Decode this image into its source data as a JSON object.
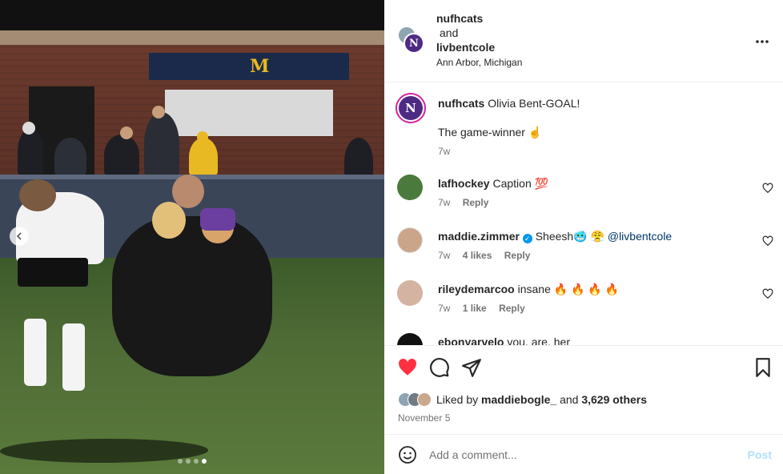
{
  "header": {
    "user1": "nufhcats",
    "and": "and",
    "user2": "livbentcole",
    "location": "Ann Arbor, Michigan",
    "avatar_letter": "N"
  },
  "caption": {
    "username": "nufhcats",
    "line1": "Olivia Bent-GOAL!",
    "line2": "The game-winner ☝️",
    "time": "7w"
  },
  "comments": [
    {
      "username": "lafhockey",
      "text": "Caption 💯",
      "time": "7w",
      "likes": "",
      "reply": "Reply"
    },
    {
      "username": "maddie.zimmer",
      "text": "Sheesh🥶 😤",
      "mention": "@livbentcole",
      "time": "7w",
      "likes": "4 likes",
      "reply": "Reply",
      "verified": true
    },
    {
      "username": "rileydemarcoo",
      "text": "insane 🔥 🔥 🔥 🔥",
      "time": "7w",
      "likes": "1 like",
      "reply": "Reply"
    },
    {
      "username": "ebonyarvelo",
      "text": "you. are. her"
    }
  ],
  "likes": {
    "prefix": "Liked by",
    "user": "maddiebogle_",
    "middle": "and",
    "count": "3,629 others"
  },
  "date": "November 5",
  "comment_box": {
    "placeholder": "Add a comment...",
    "post": "Post"
  },
  "carousel": {
    "total": 4,
    "active": 4
  },
  "colors": {
    "like_red": "#ff3040",
    "nu_purple": "#4e2a84",
    "link_blue": "#00376b",
    "post_blue": "#b2dffc"
  }
}
